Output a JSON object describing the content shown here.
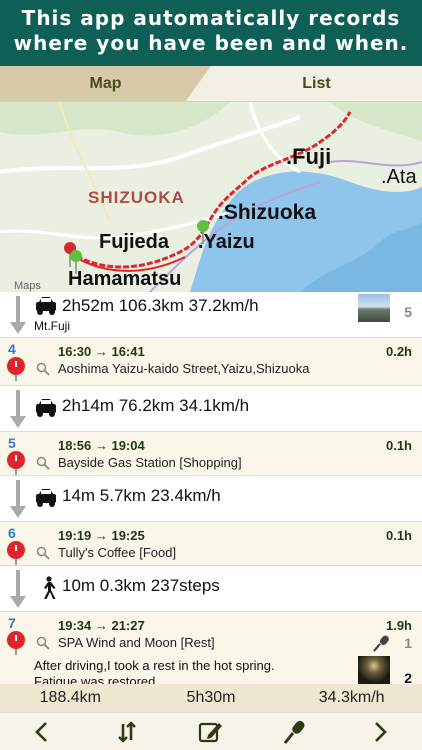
{
  "banner": {
    "line1": "This app automatically records",
    "line2": "where you have been and when."
  },
  "tabs": [
    {
      "label": "Map",
      "active": true
    },
    {
      "label": "List",
      "active": false
    }
  ],
  "map": {
    "labels": {
      "fuji": ".Fuji",
      "ata": ".Ata",
      "shizuoka_pref": "SHIZUOKA",
      "shizuoka_city": ".Shizuoka",
      "fujieda": "Fujieda",
      "yaizu": ".Yaizu",
      "hamamatsu": "Hamamatsu",
      "maps": "Maps"
    },
    "colors": {
      "route": "#e0232c",
      "sea": "#8fc5ea",
      "land": "#e9efe1",
      "road": "#ffffff"
    }
  },
  "list": {
    "move1": {
      "stats": "2h52m   106.3km   37.2km/h",
      "sub": "Mt.Fuji",
      "count": "5",
      "mode": "car-icon"
    },
    "stop4": {
      "index": "4",
      "time": "16:30 → 16:41",
      "duration": "0.2h",
      "place": "Aoshima Yaizu-kaido Street,Yaizu,Shizuoka"
    },
    "move2": {
      "stats": "2h14m   76.2km   34.1km/h",
      "mode": "car-icon"
    },
    "stop5": {
      "index": "5",
      "time": "18:56 → 19:04",
      "duration": "0.1h",
      "place": "Bayside Gas Station [Shopping]"
    },
    "move3": {
      "stats": "14m   5.7km   23.4km/h",
      "mode": "car-icon"
    },
    "stop6": {
      "index": "6",
      "time": "19:19 → 19:25",
      "duration": "0.1h",
      "place": "Tully's Coffee [Food]"
    },
    "move4": {
      "stats": "10m   0.3km   237steps",
      "mode": "walk-icon"
    },
    "stop7": {
      "index": "7",
      "time": "19:34 → 21:27",
      "duration": "1.9h",
      "place": "SPA Wind and Moon [Rest]",
      "voice_count": "1",
      "photo_count": "2",
      "note_line1": "After driving,I took a rest in the hot spring.",
      "note_line2": "Fatigue was restored."
    }
  },
  "totals": {
    "distance": "188.4km",
    "time": "5h30m",
    "speed": "34.3km/h"
  },
  "toolbar": {
    "icons": [
      "chevron-left-icon",
      "sort-icon",
      "edit-icon",
      "microphone-icon",
      "chevron-right-icon"
    ]
  }
}
